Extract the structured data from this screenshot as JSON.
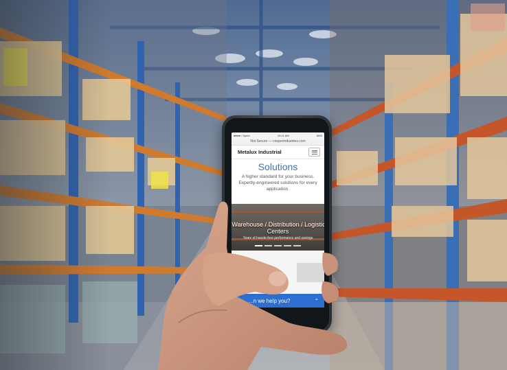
{
  "scene": {
    "description_colors": {
      "shelf_orange": "#c4562a",
      "rack_blue": "#3a6fb5",
      "accent_blue": "#3a74b8",
      "chat_blue": "#2d6fd0"
    }
  },
  "phone": {
    "status_bar": {
      "left": "●●●●○ Sprint",
      "time": "10:21 AM",
      "battery": "86%"
    },
    "url_bar": {
      "text": "Not Secure — cooperindustries.com"
    },
    "site": {
      "brand": "Metalux Industrial",
      "menu_icon": "hamburger-menu-icon",
      "heading": "Solutions",
      "description": "A higher standard for your business. Expertly-engineered solutions for every application.",
      "hero": {
        "title_line1": "Warehouse / Distribution / Logistic",
        "title_line2": "Centers",
        "subtitle": "Years of hassle-free performance and savings",
        "slides": 5,
        "active_slide": 1
      },
      "help_bar": {
        "text": "...n we help you?",
        "icon": "chevron-up-icon"
      }
    }
  }
}
